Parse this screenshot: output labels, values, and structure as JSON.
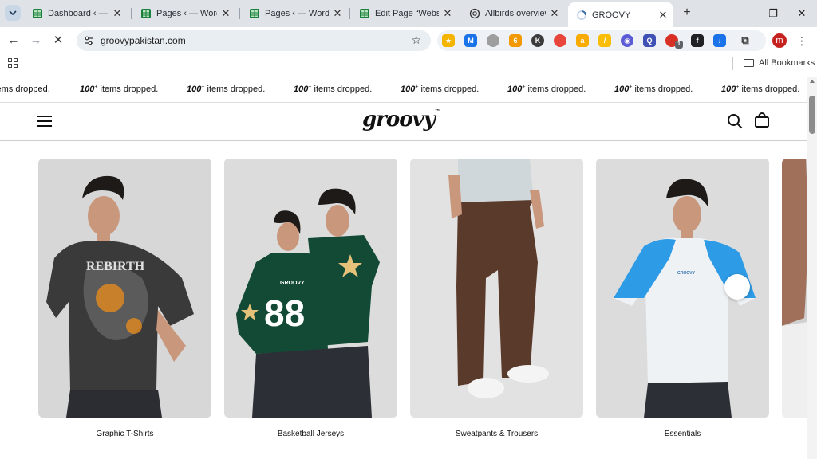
{
  "browser": {
    "tabs": [
      {
        "title": "Dashboard ‹ — W",
        "favicon": "sheets-icon"
      },
      {
        "title": "Pages ‹ — WordPr",
        "favicon": "sheets-icon"
      },
      {
        "title": "Pages ‹ — WordPr",
        "favicon": "sheets-icon"
      },
      {
        "title": "Edit Page “Websit",
        "favicon": "sheets-icon"
      },
      {
        "title": "Allbirds overview a",
        "favicon": "chatgpt-icon"
      },
      {
        "title": "GROOVY",
        "favicon": "loading-icon"
      }
    ],
    "url": "groovypakistan.com",
    "profile_initial": "m",
    "ext_badge": "1",
    "all_bookmarks": "All Bookmarks"
  },
  "site": {
    "ticker_num": "100",
    "ticker_sup": "+",
    "ticker_text": "items dropped.",
    "logo": "groovy",
    "logo_tm": "™",
    "categories": [
      {
        "label": "Graphic T-Shirts"
      },
      {
        "label": "Basketball Jerseys"
      },
      {
        "label": "Sweatpants & Trousers"
      },
      {
        "label": "Essentials"
      }
    ]
  },
  "colors": {
    "accent_blue": "#2e9be6",
    "jersey_green": "#134a36",
    "pants_brown": "#5a3a2b"
  }
}
